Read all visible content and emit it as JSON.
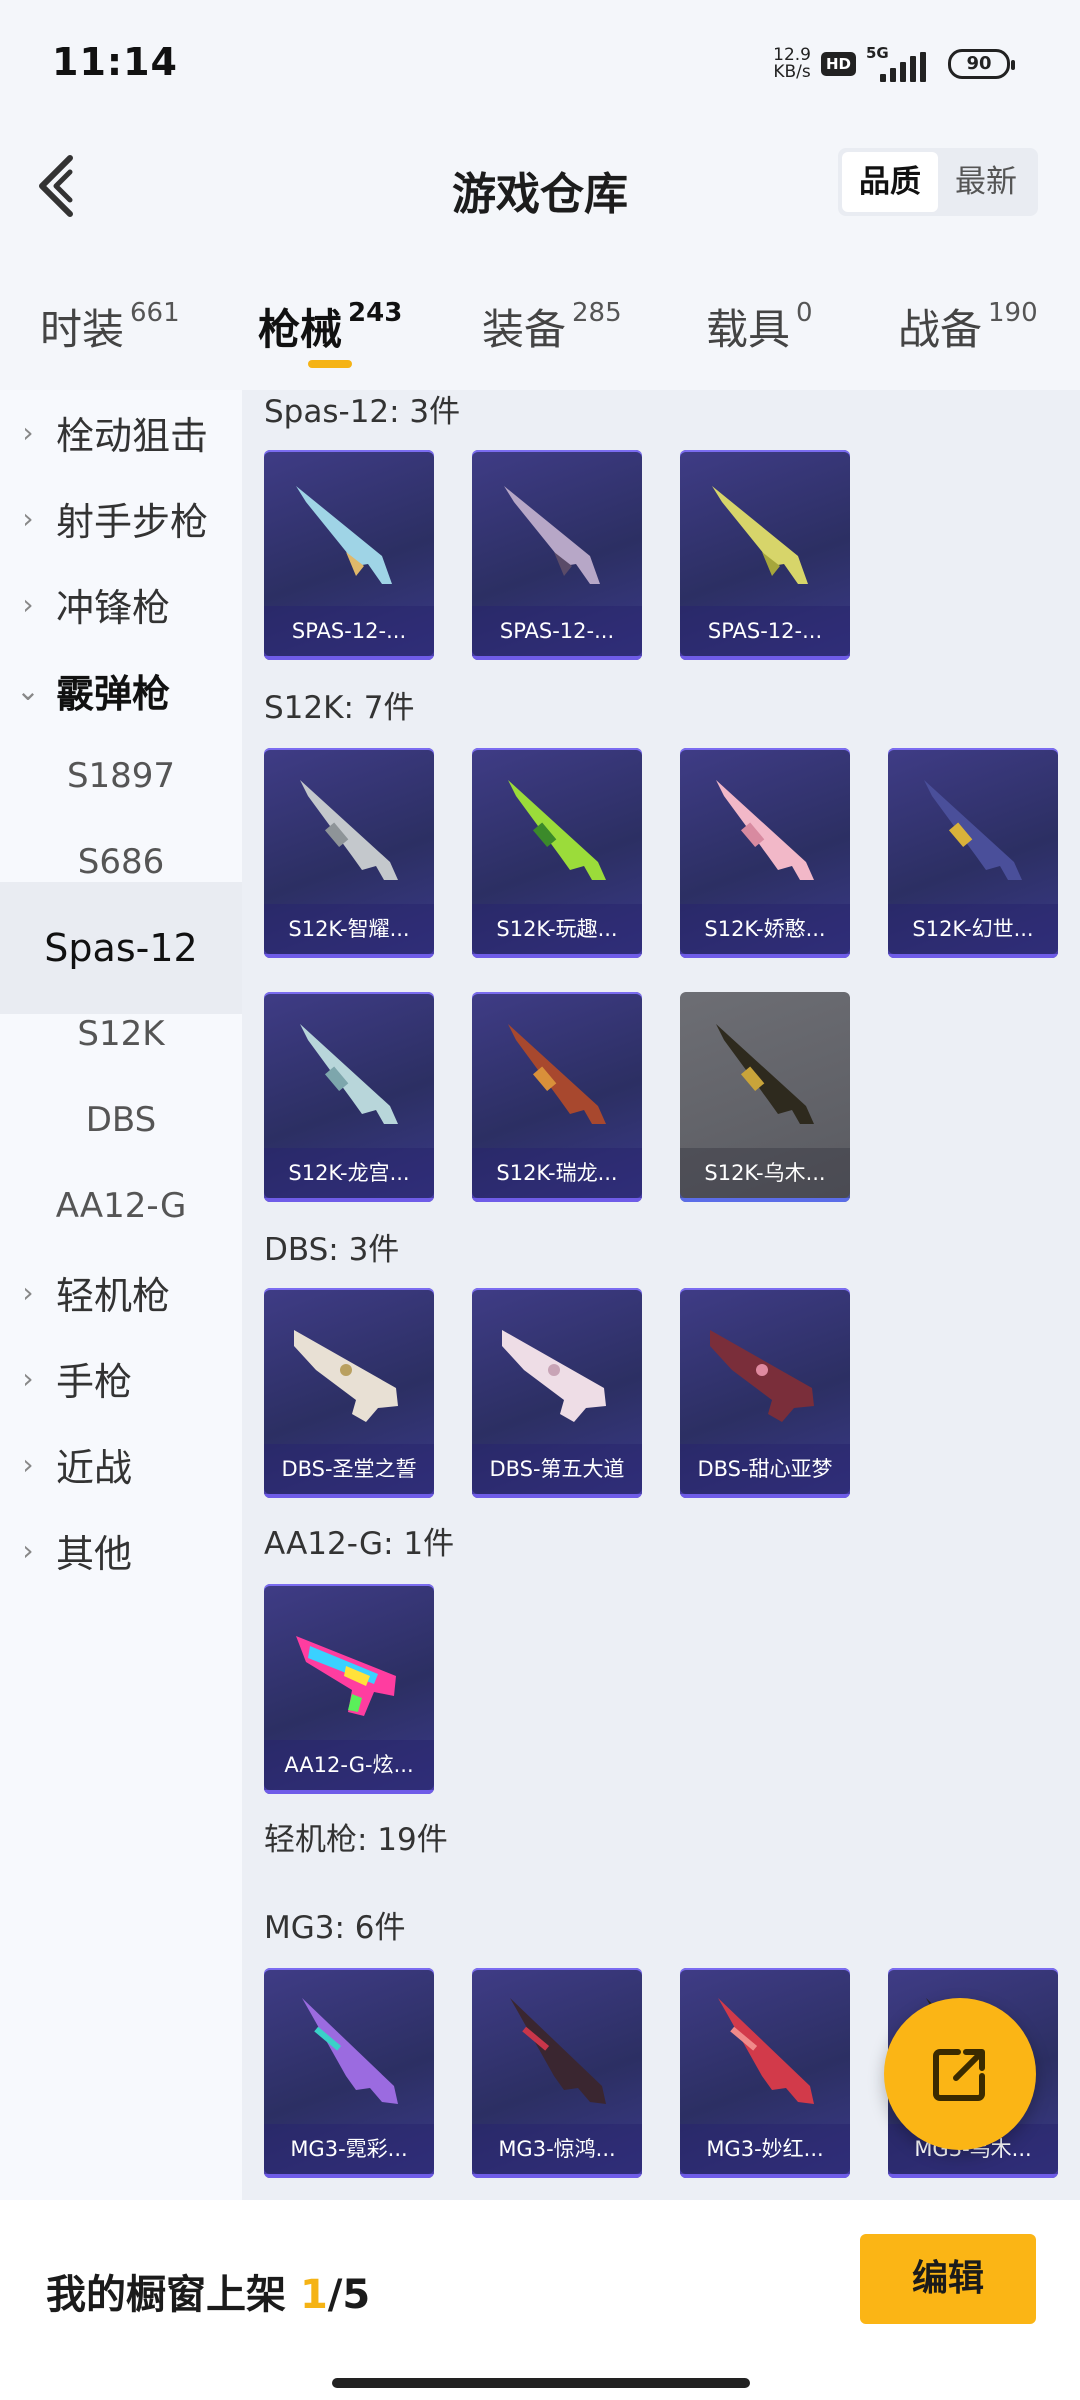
{
  "status": {
    "time": "11:14",
    "speed_value": "12.9",
    "speed_unit": "KB/s",
    "hd": "HD",
    "net": "5G",
    "battery": "90"
  },
  "header": {
    "title": "游戏仓库",
    "sort_options": [
      "品质",
      "最新"
    ],
    "active_sort": "品质"
  },
  "tabs": [
    {
      "label": "时装",
      "count": "661"
    },
    {
      "label": "枪械",
      "count": "243",
      "active": true
    },
    {
      "label": "装备",
      "count": "285"
    },
    {
      "label": "载具",
      "count": "0"
    },
    {
      "label": "战备",
      "count": "190"
    }
  ],
  "sidebar": {
    "items": [
      {
        "label": "栓动狙击",
        "type": "category"
      },
      {
        "label": "射手步枪",
        "type": "category"
      },
      {
        "label": "冲锋枪",
        "type": "category"
      },
      {
        "label": "霰弹枪",
        "type": "category",
        "open": true
      },
      {
        "label": "S1897",
        "type": "sub"
      },
      {
        "label": "S686",
        "type": "sub"
      },
      {
        "label": "Spas-12",
        "type": "sub",
        "selected": true
      },
      {
        "label": "S12K",
        "type": "sub"
      },
      {
        "label": "DBS",
        "type": "sub"
      },
      {
        "label": "AA12-G",
        "type": "sub"
      },
      {
        "label": "轻机枪",
        "type": "category"
      },
      {
        "label": "手枪",
        "type": "category"
      },
      {
        "label": "近战",
        "type": "category"
      },
      {
        "label": "其他",
        "type": "category"
      }
    ]
  },
  "groups": {
    "spas12": {
      "title": "Spas-12: 3件",
      "items": [
        "SPAS-12-...",
        "SPAS-12-...",
        "SPAS-12-..."
      ]
    },
    "s12k": {
      "title": "S12K: 7件",
      "items": [
        "S12K-智耀...",
        "S12K-玩趣...",
        "S12K-娇憨...",
        "S12K-幻世...",
        "S12K-龙宫...",
        "S12K-瑞龙...",
        "S12K-乌木..."
      ]
    },
    "dbs": {
      "title": "DBS: 3件",
      "items": [
        "DBS-圣堂之誓",
        "DBS-第五大道",
        "DBS-甜心亚梦"
      ]
    },
    "aa12": {
      "title": "AA12-G: 1件",
      "items": [
        "AA12-G-炫..."
      ]
    },
    "lmg": {
      "title": "轻机枪: 19件"
    },
    "mg3": {
      "title": "MG3: 6件",
      "items": [
        "MG3-霓彩...",
        "MG3-惊鸿...",
        "MG3-妙红...",
        "MG3-乌木..."
      ]
    }
  },
  "bottom": {
    "label_prefix": "我的橱窗上架",
    "current": "1",
    "total": "/5",
    "edit_label": "编辑"
  },
  "colors": {
    "accent": "#fbb515",
    "card_bg": "#2c2f63",
    "card_border": "#6f5ce8"
  },
  "icons": [
    "back-arrow-icon",
    "chevron-right-icon",
    "chevron-down-icon",
    "share-external-icon",
    "gun-icon"
  ]
}
